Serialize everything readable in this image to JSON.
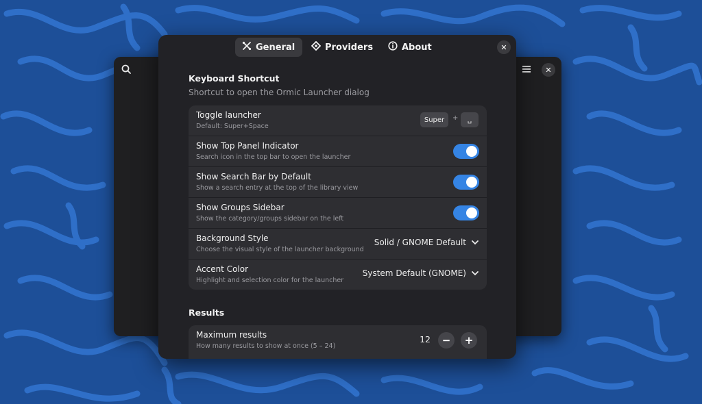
{
  "tabs": [
    {
      "label": "General",
      "icon": "tools-icon",
      "active": true
    },
    {
      "label": "Providers",
      "icon": "puzzle-icon",
      "active": false
    },
    {
      "label": "About",
      "icon": "info-icon",
      "active": false
    }
  ],
  "keyboard": {
    "title": "Keyboard Shortcut",
    "subtitle": "Shortcut to open the Ormic Launcher dialog",
    "rows": [
      {
        "title": "Toggle launcher",
        "subtitle": "Default: Super+Space",
        "keys": [
          "Super",
          "+",
          "␣"
        ]
      },
      {
        "title": "Show Top Panel Indicator",
        "subtitle": "Search icon in the top bar to open the launcher",
        "enabled": true
      },
      {
        "title": "Show Search Bar by Default",
        "subtitle": "Show a search entry at the top of the library view",
        "enabled": true
      },
      {
        "title": "Show Groups Sidebar",
        "subtitle": "Show the category/groups sidebar on the left",
        "enabled": true
      },
      {
        "title": "Background Style",
        "subtitle": "Choose the visual style of the launcher background",
        "value": "Solid / GNOME Default"
      },
      {
        "title": "Accent Color",
        "subtitle": "Highlight and selection color for the launcher",
        "value": "System Default (GNOME)"
      }
    ]
  },
  "results": {
    "title": "Results",
    "rows": [
      {
        "title": "Maximum results",
        "subtitle": "How many results to show at once (5 – 24)",
        "value": "12",
        "minus": "−",
        "plus": "+"
      }
    ]
  },
  "colors": {
    "accent": "#3584e4",
    "wallpaper": "#1d4f98",
    "wallpaper_light": "#2f6fc8",
    "dialog_bg": "#222226",
    "card_bg": "#2e2e32"
  }
}
